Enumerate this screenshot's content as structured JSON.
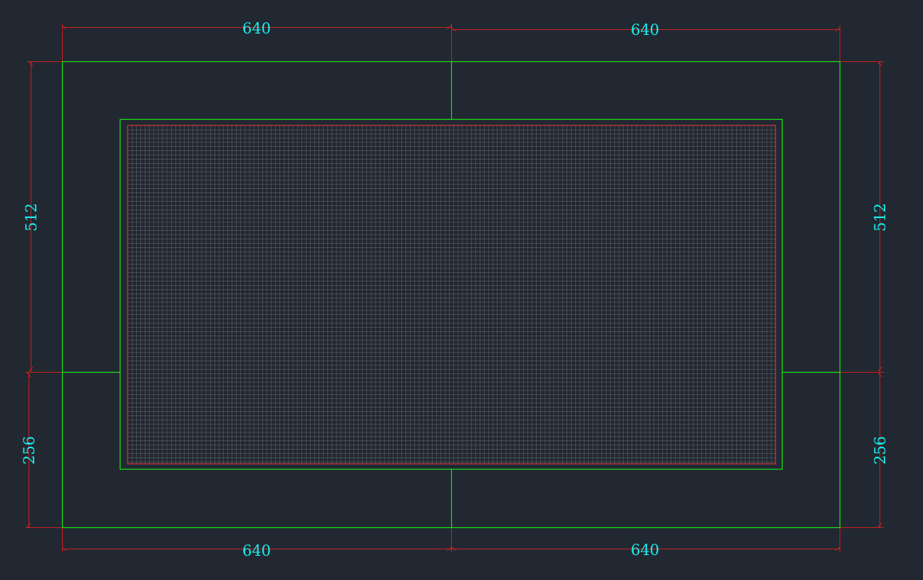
{
  "colors": {
    "background": "#222831",
    "outline": "#19e619",
    "dimension": "#cc1f1f",
    "dimension_text": "#19f0f0",
    "mesh": "#7f858c",
    "mesh_border": "#d6343f"
  },
  "dimensions": {
    "top_left": "640",
    "top_right": "640",
    "bottom_left": "640",
    "bottom_right": "640",
    "left_upper": "512",
    "left_lower": "256",
    "right_upper": "512",
    "right_lower": "256"
  }
}
